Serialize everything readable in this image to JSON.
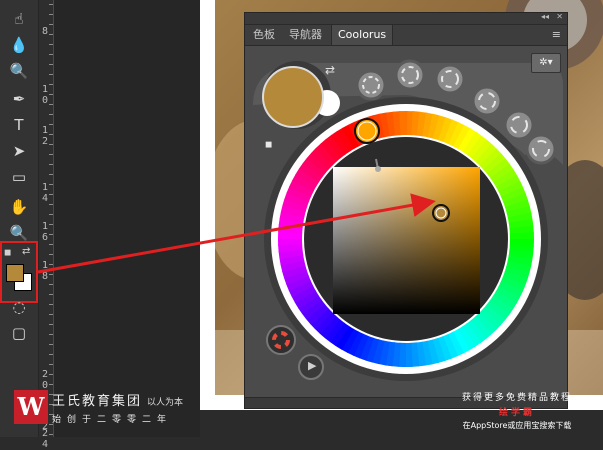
{
  "toolbar": {
    "tools": [
      {
        "name": "smudge-tool-icon",
        "glyph": "☝"
      },
      {
        "name": "drop-tool-icon",
        "glyph": "💧"
      },
      {
        "name": "zoom-tool-icon",
        "glyph": "🔍"
      },
      {
        "name": "pen-tool-icon",
        "glyph": "✒"
      },
      {
        "name": "type-tool-icon",
        "glyph": "T"
      },
      {
        "name": "path-select-tool-icon",
        "glyph": "➤"
      },
      {
        "name": "shape-tool-icon",
        "glyph": "▭"
      },
      {
        "name": "hand-tool-icon",
        "glyph": "✋"
      },
      {
        "name": "zoom-tool-icon-2",
        "glyph": "🔍"
      }
    ],
    "foreground_color": "#b5893a",
    "background_color": "#ffffff",
    "quick_mask_glyph": "◌",
    "screen_mode_glyph": "▢"
  },
  "ruler": {
    "labels": [
      {
        "text": "8"
      },
      {
        "text": "1\n0"
      },
      {
        "text": "1\n2"
      },
      {
        "text": "1\n4"
      },
      {
        "text": "1\n6"
      },
      {
        "text": "1\n8"
      },
      {
        "text": "2\n0"
      },
      {
        "text": "2\n2"
      },
      {
        "text": "2\n4"
      }
    ]
  },
  "panel": {
    "tabs": [
      "色板",
      "导航器",
      "Coolorus"
    ],
    "active_tab": "Coolorus",
    "collapse_glyph": "◂◂",
    "close_glyph": "✕",
    "menu_glyph": "≡",
    "current_color": "#b5893a",
    "previous_color": "#ffffff",
    "picker_hue_color": "#ffa500",
    "settings_glyph": "✲▾",
    "play_glyph": "▶",
    "swap_glyph": "⇄"
  },
  "accent": {
    "callout_red": "#e02020"
  },
  "watermark": {
    "logo_letter": "W",
    "title": "王氏教育集团",
    "motto": "以人为本",
    "subtitle": "始创于二零零二年",
    "promo_line1": "获得更多免费精品教程",
    "promo_line2": "绘学霸",
    "promo_line3": "在AppStore或应用宝搜索下载"
  }
}
